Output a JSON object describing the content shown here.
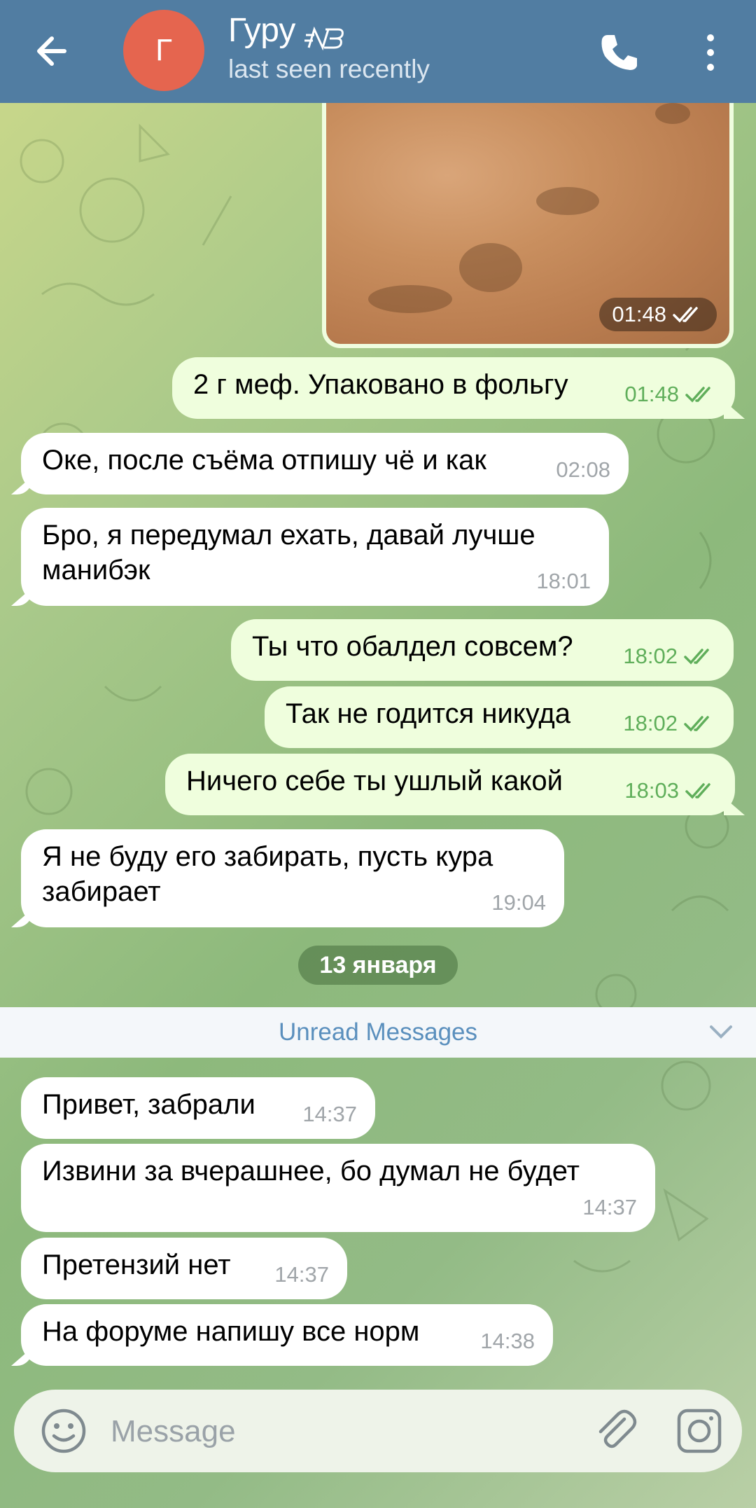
{
  "header": {
    "back_icon": "arrow-left-icon",
    "avatar_letter": "Г",
    "avatar_color": "#e5654f",
    "title": "Гуру",
    "title_badge_icon": "new-balance-logo-icon",
    "status": "last seen recently",
    "call_icon": "phone-icon",
    "more_icon": "more-vertical-icon",
    "bar_color": "#517da2"
  },
  "photo": {
    "time": "01:48",
    "read_icon": "double-check-icon"
  },
  "messages": [
    {
      "dir": "out",
      "text": "2 г меф. Упаковано в фольгу",
      "time": "01:48"
    },
    {
      "dir": "in",
      "text": "Оке, после съёма отпишу чё и как",
      "time": "02:08"
    },
    {
      "dir": "in",
      "text": "Бро, я передумал ехать, давай лучше манибэк",
      "time": "18:01"
    },
    {
      "dir": "out",
      "text": "Ты что обалдел совсем?",
      "time": "18:02"
    },
    {
      "dir": "out",
      "text": "Так не годится никуда",
      "time": "18:02"
    },
    {
      "dir": "out",
      "text": "Ничего себе ты ушлый какой",
      "time": "18:03"
    },
    {
      "dir": "in",
      "text": "Я не буду его забирать, пусть кура забирает",
      "time": "19:04"
    },
    {
      "dir": "in",
      "text": "Привет, забрали",
      "time": "14:37"
    },
    {
      "dir": "in",
      "text": "Извини за вчерашнее, бо думал не будет",
      "time": "14:37"
    },
    {
      "dir": "in",
      "text": "Претензий нет",
      "time": "14:37"
    },
    {
      "dir": "in",
      "text": "На форуме напишу все норм",
      "time": "14:38"
    }
  ],
  "date_separator": "13 января",
  "unread": {
    "label": "Unread Messages",
    "icon": "chevron-down-icon"
  },
  "composer": {
    "placeholder": "Message",
    "emoji_icon": "smile-icon",
    "attach_icon": "paperclip-icon",
    "camera_icon": "camera-icon"
  },
  "colors": {
    "incoming": "#ffffff",
    "outgoing": "#effedd",
    "outgoing_meta": "#5fae5a",
    "accent": "#5a8fbd"
  }
}
